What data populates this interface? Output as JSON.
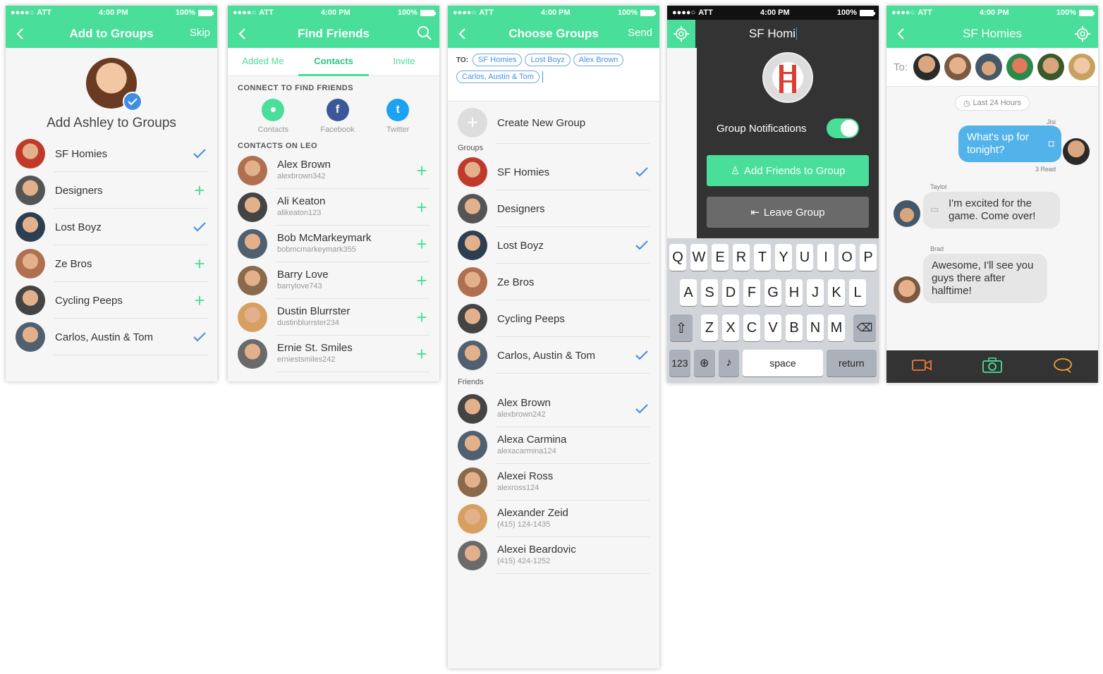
{
  "status": {
    "carrier": "ATT",
    "time": "4:00 PM",
    "battery": "100%"
  },
  "screen1": {
    "title": "Add to Groups",
    "right": "Skip",
    "heading": "Add Ashley to Groups",
    "rows": [
      {
        "name": "SF Homies",
        "state": "check"
      },
      {
        "name": "Designers",
        "state": "plus"
      },
      {
        "name": "Lost Boyz",
        "state": "check"
      },
      {
        "name": "Ze Bros",
        "state": "plus"
      },
      {
        "name": "Cycling Peeps",
        "state": "plus"
      },
      {
        "name": "Carlos, Austin & Tom",
        "state": "check"
      }
    ]
  },
  "screen2": {
    "title": "Find Friends",
    "tabs": [
      "Added Me",
      "Contacts",
      "Invite"
    ],
    "connect_header": "CONNECT TO FIND FRIENDS",
    "connect": [
      "Contacts",
      "Facebook",
      "Twitter"
    ],
    "contacts_header": "CONTACTS ON LEO",
    "rows": [
      {
        "name": "Alex Brown",
        "user": "alexbrown342"
      },
      {
        "name": "Ali Keaton",
        "user": "alikeaton123"
      },
      {
        "name": "Bob McMarkeymark",
        "user": "bobmcmarkeymark355"
      },
      {
        "name": "Barry Love",
        "user": "barrylove743"
      },
      {
        "name": "Dustin Blurrster",
        "user": "dustinblurrster234"
      },
      {
        "name": "Ernie St. Smiles",
        "user": "erniestsmiles242"
      }
    ]
  },
  "screen3": {
    "title": "Choose Groups",
    "right": "Send",
    "to_label": "TO:",
    "chips": [
      "SF Homies",
      "Lost Boyz",
      "Alex Brown",
      "Carlos, Austin & Tom"
    ],
    "create": "Create New Group",
    "groups_header": "Groups",
    "groups": [
      {
        "name": "SF Homies",
        "state": "check"
      },
      {
        "name": "Designers",
        "state": ""
      },
      {
        "name": "Lost Boyz",
        "state": "check"
      },
      {
        "name": "Ze Bros",
        "state": ""
      },
      {
        "name": "Cycling Peeps",
        "state": ""
      },
      {
        "name": "Carlos, Austin & Tom",
        "state": "check"
      }
    ],
    "friends_header": "Friends",
    "friends": [
      {
        "name": "Alex Brown",
        "sub": "alexbrown242",
        "state": "check"
      },
      {
        "name": "Alexa Carmina",
        "sub": "alexacarmina124",
        "state": ""
      },
      {
        "name": "Alexei Ross",
        "sub": "alexross124",
        "state": ""
      },
      {
        "name": "Alexander Zeid",
        "sub": "(415) 124-1435",
        "state": ""
      },
      {
        "name": "Alexei Beardovic",
        "sub": "(415) 424-1252",
        "state": ""
      }
    ]
  },
  "screen4": {
    "title": "SF Homi",
    "notif": "Group Notifications",
    "add": "Add Friends to Group",
    "leave": "Leave Group",
    "keys": [
      [
        "Q",
        "W",
        "E",
        "R",
        "T",
        "Y",
        "U",
        "I",
        "O",
        "P"
      ],
      [
        "A",
        "S",
        "D",
        "F",
        "G",
        "H",
        "J",
        "K",
        "L"
      ],
      [
        "Z",
        "X",
        "C",
        "V",
        "B",
        "N",
        "M"
      ]
    ],
    "k123": "123",
    "space": "space",
    "ret": "return"
  },
  "screen5": {
    "title": "SF Homies",
    "to": "To:",
    "pill": "Last 24 Hours",
    "m1_author": "Jisi",
    "m1": "What's up for tonight?",
    "m1_read": "3 Read",
    "m2_author": "Taylor",
    "m2": "I'm excited for the game. Come over!",
    "m3_author": "Brad",
    "m3": "Awesome, I'll see you guys there after halftime!"
  },
  "colors": {
    "accent": "#49de99",
    "blue": "#4a90e2",
    "dark": "#333333"
  }
}
